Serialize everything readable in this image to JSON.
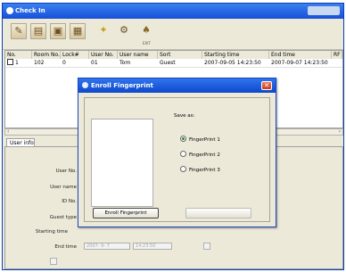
{
  "window": {
    "title": "Check In"
  },
  "toolbar": {
    "buttons": [
      {
        "icon": "edit-icon"
      },
      {
        "icon": "document-icon"
      },
      {
        "icon": "save-icon"
      },
      {
        "icon": "grid-icon"
      },
      {
        "icon": "star-icon"
      },
      {
        "icon": "tools-icon"
      },
      {
        "icon": "exit-icon",
        "caption": "EXIT"
      }
    ]
  },
  "table": {
    "columns": [
      "No.",
      "Room No.",
      "Lock#",
      "User No.",
      "User name",
      "Sort",
      "Starting time",
      "End time",
      "RF"
    ],
    "rows": [
      [
        "1",
        "102",
        "0",
        "01",
        "Tom",
        "Guest",
        "2007-09-05 14:23:50",
        "2007-09-07 14:23:50",
        ""
      ]
    ]
  },
  "tab": {
    "label": "User info"
  },
  "form": {
    "user_no": "User No.",
    "user_name": "User name",
    "id_no": "ID No.",
    "guest_type": "Guest type",
    "starting_time": "Starting time",
    "end_time": "End time",
    "end_date_value": "2007- 9- 7",
    "end_time_value": "14:23:50"
  },
  "dialog": {
    "title": "Enroll Fingerprint",
    "save_as": "Save as:",
    "options": [
      "FingerPrint 1",
      "FingerPrint 2",
      "FingerPrint 3"
    ],
    "selected": 0,
    "enroll_button": "Enroll Fingerprint"
  }
}
